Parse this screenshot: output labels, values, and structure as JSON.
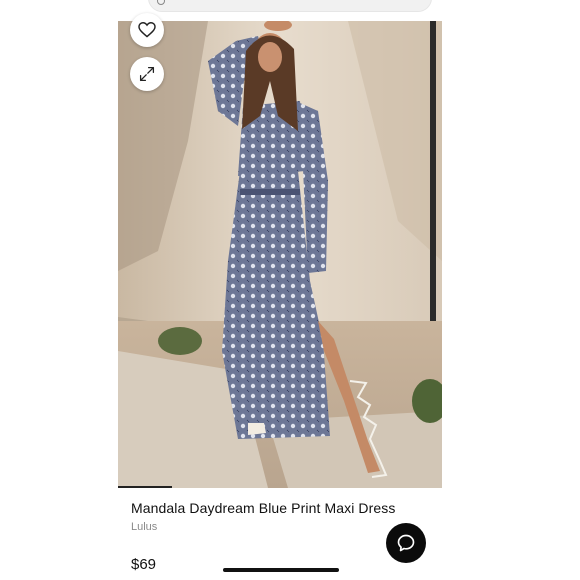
{
  "product": {
    "title": "Mandala Daydream Blue Print Maxi Dress",
    "brand": "Lulus",
    "price": "$69"
  },
  "icons": {
    "favorite": "heart-icon",
    "expand": "expand-icon",
    "chat": "chat-bubble-icon",
    "search": "search-icon"
  },
  "colors": {
    "background": "#ffffff",
    "text": "#111111",
    "brand_text": "#8a8a8a",
    "chat_button": "#0b0b0b"
  }
}
